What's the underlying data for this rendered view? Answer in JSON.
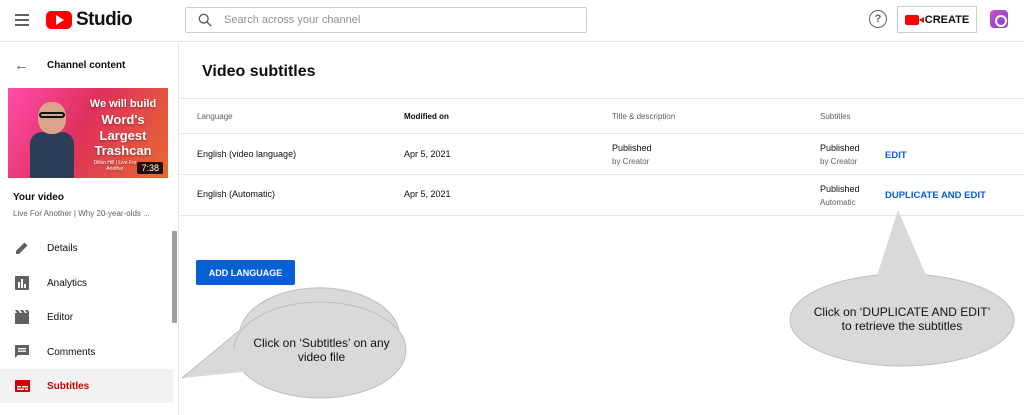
{
  "topbar": {
    "logo_text": "Studio",
    "search_placeholder": "Search across your channel",
    "create_label": "CREATE",
    "help_glyph": "?"
  },
  "sidebar": {
    "back_label": "Channel content",
    "thumbnail": {
      "line1": "We will build",
      "line2": "Word's",
      "line3": "Largest",
      "line4": "Trashcan",
      "line5": "Dillon Hill | Live For Another",
      "duration": "7:38"
    },
    "your_video_label": "Your video",
    "video_title": "Live For Another | Why 20-year-olds ...",
    "items": [
      {
        "label": "Details",
        "icon": "pencil-icon"
      },
      {
        "label": "Analytics",
        "icon": "bar-chart-icon"
      },
      {
        "label": "Editor",
        "icon": "film-icon"
      },
      {
        "label": "Comments",
        "icon": "comment-icon"
      },
      {
        "label": "Subtitles",
        "icon": "subtitles-icon",
        "active": true
      }
    ]
  },
  "main": {
    "title": "Video subtitles",
    "columns": [
      "Language",
      "Modified on",
      "Title & description",
      "Subtitles"
    ],
    "rows": [
      {
        "language": "English (video language)",
        "modified": "Apr 5, 2021",
        "title_status": "Published",
        "title_by": "by Creator",
        "subs_status": "Published",
        "subs_by": "by Creator",
        "action": "EDIT"
      },
      {
        "language": "English (Automatic)",
        "modified": "Apr 5, 2021",
        "title_status": "",
        "title_by": "",
        "subs_status": "Published",
        "subs_by": "Automatic",
        "action": "DUPLICATE AND EDIT"
      }
    ],
    "add_language_label": "ADD LANGUAGE"
  },
  "callouts": {
    "left_line1": "Click on ‘Subtitles’ on any",
    "left_line2": "video file",
    "right_line1": "Click on ‘DUPLICATE AND EDIT’",
    "right_line2": "to retrieve the subtitles"
  },
  "colors": {
    "brand_red": "#ff0000",
    "active_red": "#cc0000",
    "link_blue": "#065fd4",
    "callout_fill": "#d9d9d9"
  }
}
